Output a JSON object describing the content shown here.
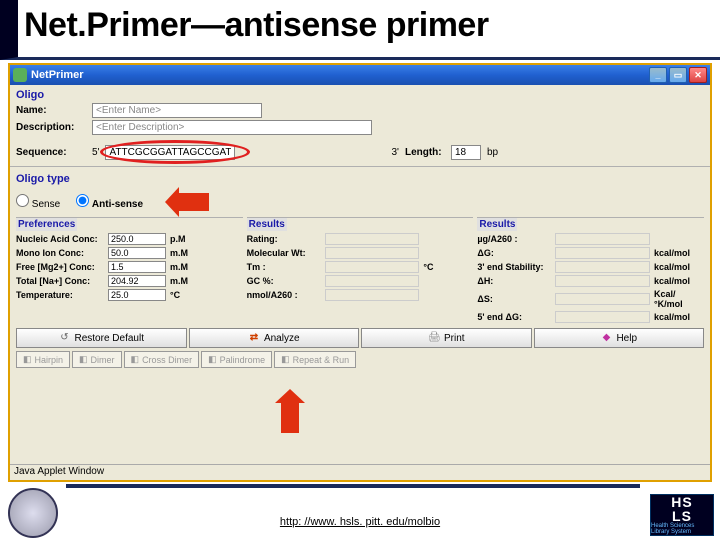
{
  "slide": {
    "title": "Net.Primer—antisense primer"
  },
  "window": {
    "title": "NetPrimer",
    "oligo_section": "Oligo",
    "name_label": "Name:",
    "name_value": "<Enter Name>",
    "desc_label": "Description:",
    "desc_value": "<Enter Description>",
    "seq_label": "Sequence:",
    "seq_5": "5'",
    "seq_value": "ATTCGCGGATTAGCCGAT",
    "seq_3": "3'",
    "length_label": "Length:",
    "length_value": "18",
    "length_unit": "bp",
    "oligo_type_section": "Oligo type",
    "sense": "Sense",
    "antisense": "Anti-sense",
    "prefs_section": "Preferences",
    "results_section": "Results",
    "prefs": [
      {
        "label": "Nucleic Acid Conc:",
        "value": "250.0",
        "unit": "p.M"
      },
      {
        "label": "Mono Ion Conc:",
        "value": "50.0",
        "unit": "m.M"
      },
      {
        "label": "Free [Mg2+] Conc:",
        "value": "1.5",
        "unit": "m.M"
      },
      {
        "label": "Total [Na+] Conc:",
        "value": "204.92",
        "unit": "m.M"
      },
      {
        "label": "Temperature:",
        "value": "25.0",
        "unit": "°C"
      }
    ],
    "results1": [
      {
        "label": "Rating:",
        "unit": ""
      },
      {
        "label": "Molecular Wt:",
        "unit": ""
      },
      {
        "label": "Tm :",
        "unit": "°C"
      },
      {
        "label": "GC %:",
        "unit": ""
      },
      {
        "label": "nmol/A260 :",
        "unit": ""
      }
    ],
    "results2": [
      {
        "label": "µg/A260 :",
        "unit": ""
      },
      {
        "label": "ΔG:",
        "unit": "kcal/mol"
      },
      {
        "label": "3' end Stability:",
        "unit": "kcal/mol"
      },
      {
        "label": "ΔH:",
        "unit": "kcal/mol"
      },
      {
        "label": "ΔS:",
        "unit": "Kcal/°K/mol"
      },
      {
        "label": "5' end ΔG:",
        "unit": "kcal/mol"
      }
    ],
    "buttons": {
      "restore": "Restore Default",
      "analyze": "Analyze",
      "print": "Print",
      "help": "Help"
    },
    "tabs": [
      "Hairpin",
      "Dimer",
      "Cross Dimer",
      "Palindrome",
      "Repeat & Run"
    ],
    "status": "Java Applet Window"
  },
  "footer": {
    "url": "http: //www. hsls. pitt. edu/molbio"
  }
}
